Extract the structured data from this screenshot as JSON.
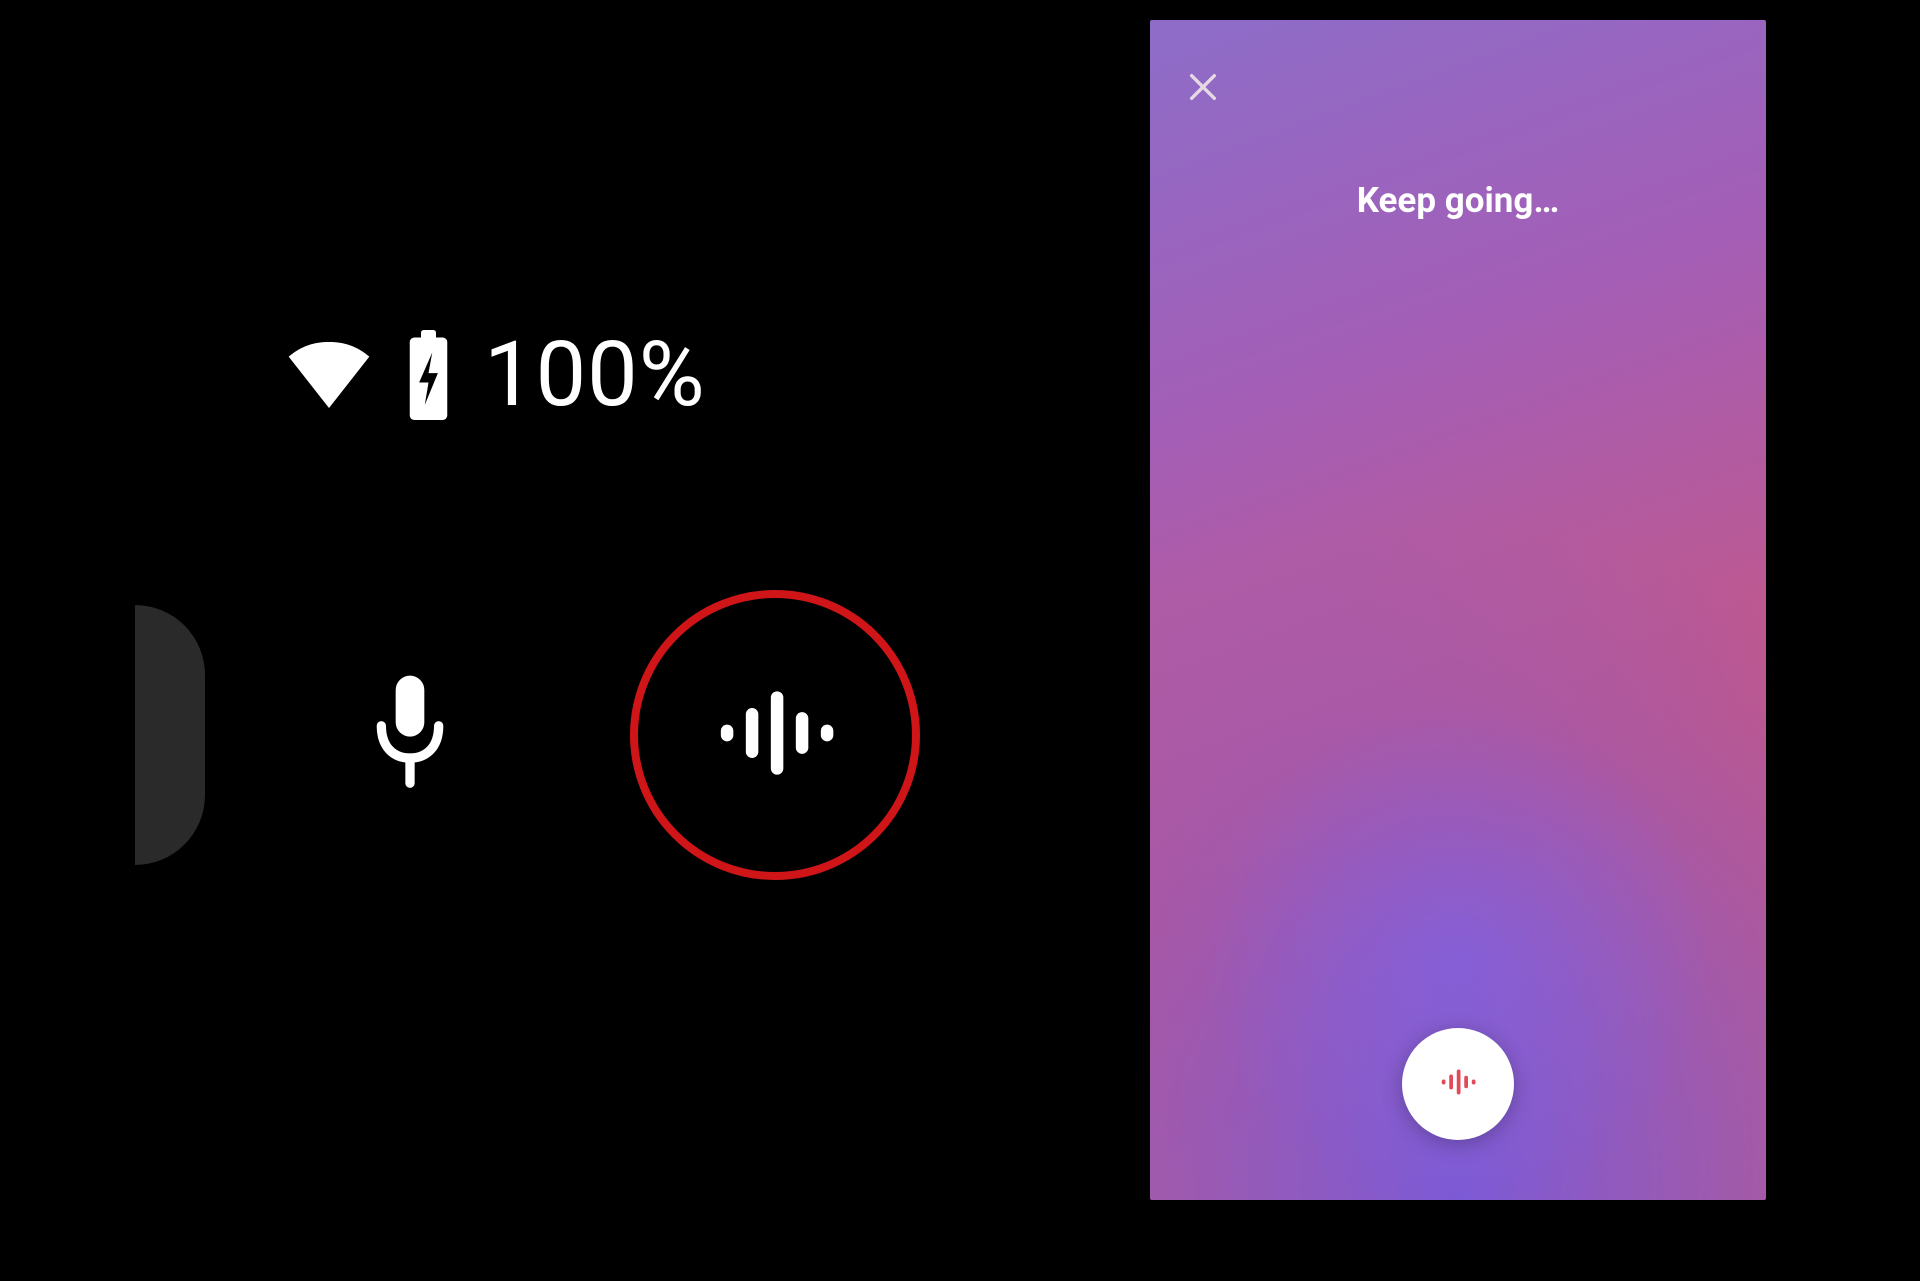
{
  "status": {
    "battery_label": "100%"
  },
  "panel": {
    "title": "Keep going…"
  },
  "colors": {
    "highlight_ring": "#d01518",
    "panel_gradient_start": "#8d6dc9",
    "panel_gradient_end": "#d35a6e"
  },
  "icons": {
    "wifi": "wifi-icon",
    "battery_charging": "battery-charging-icon",
    "microphone": "microphone-icon",
    "sound_search": "sound-search-icon",
    "close": "close-icon"
  }
}
